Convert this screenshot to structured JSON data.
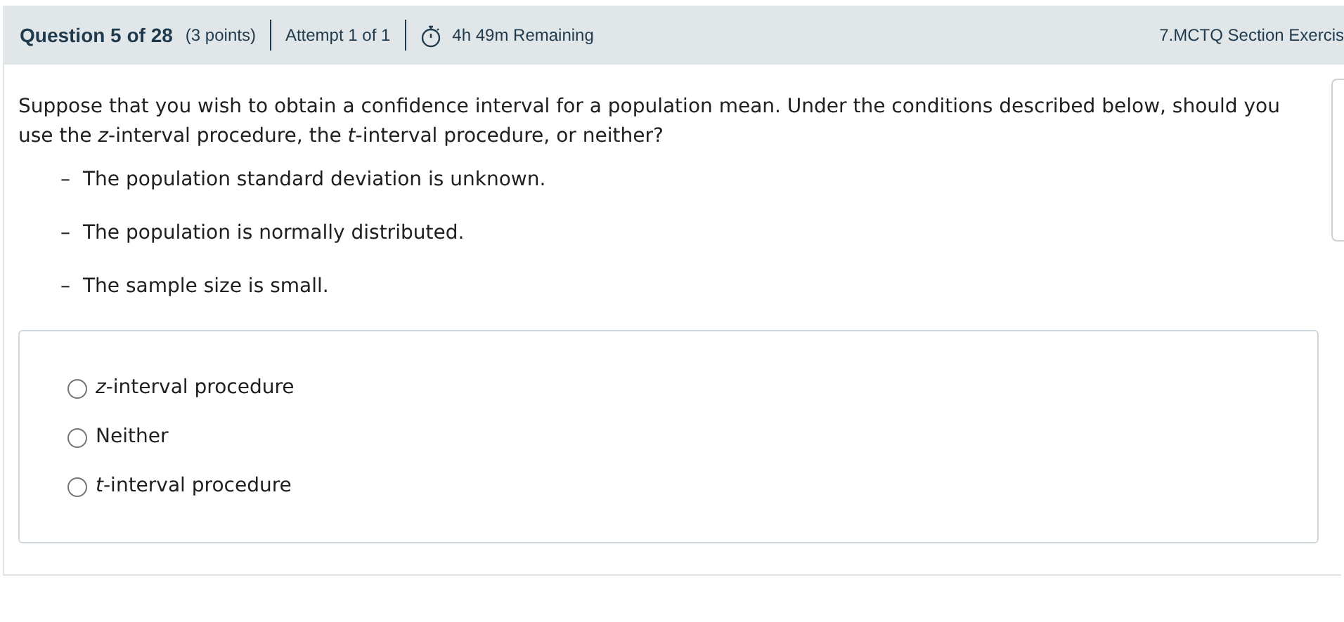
{
  "header": {
    "question": "Question 5 of 28",
    "points": "(3 points)",
    "attempt": "Attempt 1 of 1",
    "timer": "4h 49m Remaining",
    "section": "7.MCTQ Section Exercis"
  },
  "question": {
    "text": "Suppose that you wish to obtain a confidence interval for a population mean. Under the conditions described below, should you use the *z*-interval procedure, the *t*-interval procedure, or neither?",
    "conditions": [
      "The population standard deviation is unknown.",
      "The population is normally distributed.",
      "The sample size is small."
    ],
    "dash": "–"
  },
  "options": [
    {
      "label": "*z*-interval procedure",
      "selected": false
    },
    {
      "label": "Neither",
      "selected": false
    },
    {
      "label": "*t*-interval procedure",
      "selected": false
    }
  ]
}
